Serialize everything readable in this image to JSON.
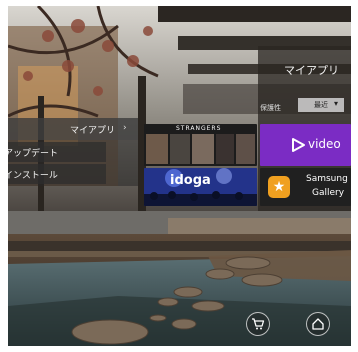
{
  "left_menu": {
    "items": [
      {
        "label": "マイアプリ",
        "chevron": "chevron-right-icon"
      },
      {
        "label": "アップデート"
      },
      {
        "label": "インストール"
      }
    ]
  },
  "header": {
    "title": "マイアプリ",
    "filter_label": "保護性",
    "sort_label": "最近",
    "sort_icon": "caret-down-icon"
  },
  "tiles": [
    {
      "name": "strangers",
      "label": "STRANGERS"
    },
    {
      "name": "video",
      "label": "video",
      "icon": "play-icon",
      "color": "#7b2cc4"
    },
    {
      "name": "idoga",
      "label": "idoga"
    },
    {
      "name": "samsung-gallery",
      "label_line1": "Samsung",
      "label_line2": "Gallery",
      "icon": "star-icon"
    }
  ],
  "bottom_buttons": [
    {
      "name": "store",
      "icon": "cart-icon"
    },
    {
      "name": "home",
      "icon": "home-icon"
    }
  ]
}
